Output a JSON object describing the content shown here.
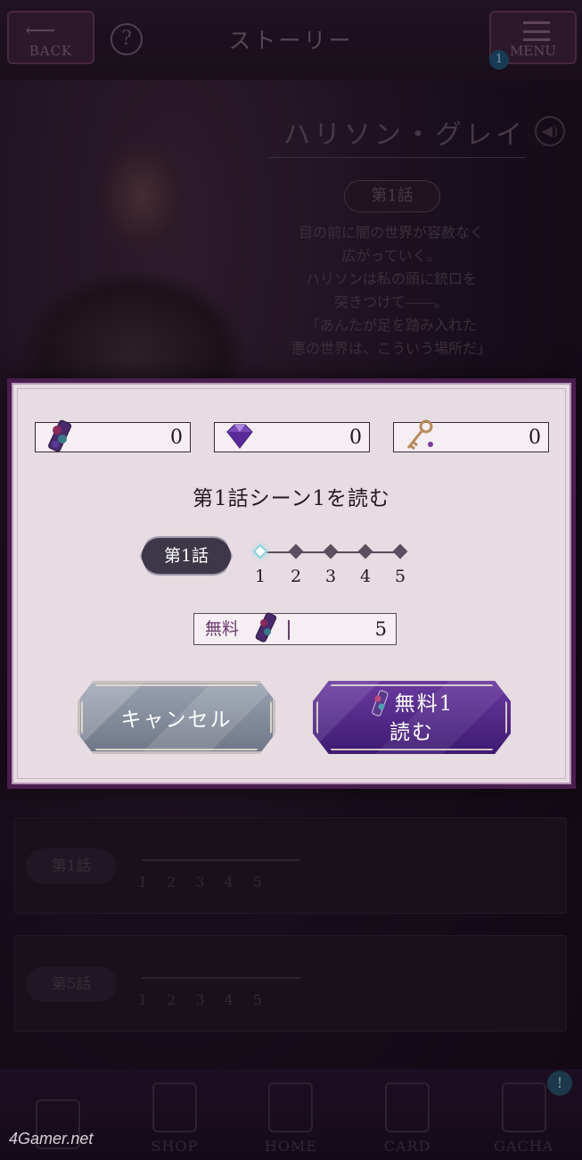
{
  "header": {
    "back_label": "BACK",
    "help_glyph": "?",
    "title": "ストーリー",
    "menu_label": "MENU",
    "menu_badge": "1"
  },
  "character": {
    "name": "ハリソン・グレイ",
    "episode_badge": "第1話",
    "synopsis": [
      "目の前に闇の世界が容赦なく",
      "広がっていく。",
      "ハリソンは私の頭に銃口を",
      "突きつけて――。",
      "「あんたが足を踏み入れた",
      "悪の世界は、こういう場所だ」"
    ]
  },
  "background_rows": [
    {
      "episode": "第1話",
      "scenes": [
        "1",
        "2",
        "3",
        "4",
        "5"
      ]
    },
    {
      "episode": "第5話",
      "scenes": [
        "1",
        "2",
        "3",
        "4",
        "5"
      ]
    }
  ],
  "bottom_nav": {
    "items": [
      {
        "label": ""
      },
      {
        "label": "SHOP"
      },
      {
        "label": "HOME"
      },
      {
        "label": "CARD"
      },
      {
        "label": "GACHA"
      }
    ],
    "gacha_badge": "!"
  },
  "watermark": "4Gamer.net",
  "modal": {
    "currencies": [
      {
        "icon": "ticket-icon",
        "value": "0"
      },
      {
        "icon": "diamond-icon",
        "value": "0"
      },
      {
        "icon": "key-icon",
        "value": "0"
      }
    ],
    "title": "第1話シーン1を読む",
    "episode_label": "第1話",
    "scenes": [
      "1",
      "2",
      "3",
      "4",
      "5"
    ],
    "active_scene": 1,
    "free_label": "無料",
    "free_value": "5",
    "cancel_label": "キャンセル",
    "read_label_top": "無料1",
    "read_label_bottom": "読む",
    "colors": {
      "frame": "#4a1d4e",
      "panel": "#e6dce1",
      "read_button": "#5a2e92",
      "cancel_button": "#868c9c"
    }
  }
}
